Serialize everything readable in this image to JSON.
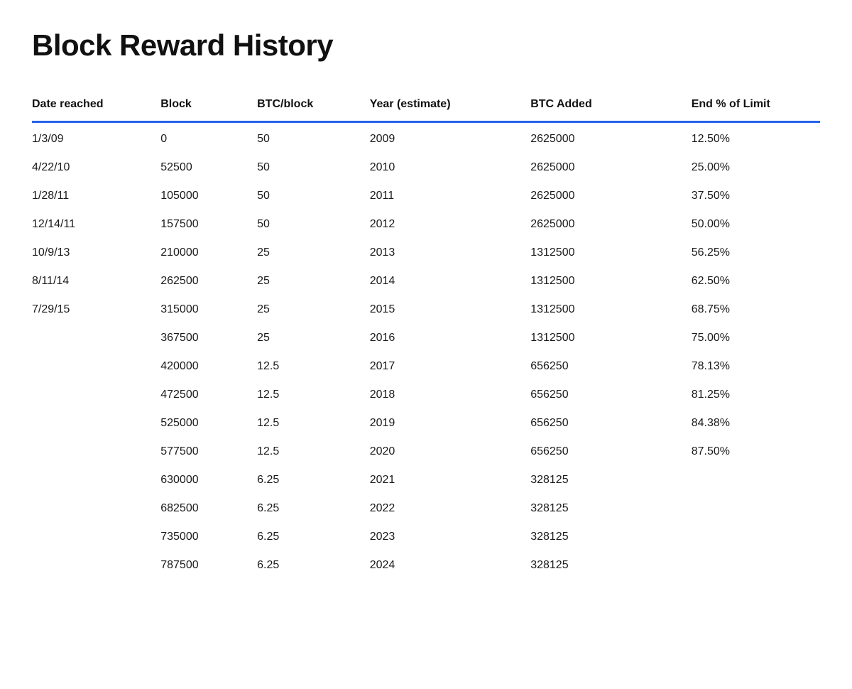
{
  "title": "Block Reward History",
  "columns": {
    "date": "Date reached",
    "block": "Block",
    "btcblock": "BTC/block",
    "year": "Year (estimate)",
    "btcadded": "BTC Added",
    "endlimit": "End % of Limit"
  },
  "rows": [
    {
      "date": "1/3/09",
      "block": "0",
      "btcblock": "50",
      "year": "2009",
      "btcadded": "2625000",
      "endlimit": "12.50%"
    },
    {
      "date": "4/22/10",
      "block": "52500",
      "btcblock": "50",
      "year": "2010",
      "btcadded": "2625000",
      "endlimit": "25.00%"
    },
    {
      "date": "1/28/11",
      "block": "105000",
      "btcblock": "50",
      "year": "2011",
      "btcadded": "2625000",
      "endlimit": "37.50%"
    },
    {
      "date": "12/14/11",
      "block": "157500",
      "btcblock": "50",
      "year": "2012",
      "btcadded": "2625000",
      "endlimit": "50.00%"
    },
    {
      "date": "10/9/13",
      "block": "210000",
      "btcblock": "25",
      "year": "2013",
      "btcadded": "1312500",
      "endlimit": "56.25%"
    },
    {
      "date": "8/11/14",
      "block": "262500",
      "btcblock": "25",
      "year": "2014",
      "btcadded": "1312500",
      "endlimit": "62.50%"
    },
    {
      "date": "7/29/15",
      "block": "315000",
      "btcblock": "25",
      "year": "2015",
      "btcadded": "1312500",
      "endlimit": "68.75%"
    },
    {
      "date": "",
      "block": "367500",
      "btcblock": "25",
      "year": "2016",
      "btcadded": "1312500",
      "endlimit": "75.00%"
    },
    {
      "date": "",
      "block": "420000",
      "btcblock": "12.5",
      "year": "2017",
      "btcadded": "656250",
      "endlimit": "78.13%"
    },
    {
      "date": "",
      "block": "472500",
      "btcblock": "12.5",
      "year": "2018",
      "btcadded": "656250",
      "endlimit": "81.25%"
    },
    {
      "date": "",
      "block": "525000",
      "btcblock": "12.5",
      "year": "2019",
      "btcadded": "656250",
      "endlimit": "84.38%"
    },
    {
      "date": "",
      "block": "577500",
      "btcblock": "12.5",
      "year": "2020",
      "btcadded": "656250",
      "endlimit": "87.50%"
    },
    {
      "date": "",
      "block": "630000",
      "btcblock": "6.25",
      "year": "2021",
      "btcadded": "328125",
      "endlimit": ""
    },
    {
      "date": "",
      "block": "682500",
      "btcblock": "6.25",
      "year": "2022",
      "btcadded": "328125",
      "endlimit": ""
    },
    {
      "date": "",
      "block": "735000",
      "btcblock": "6.25",
      "year": "2023",
      "btcadded": "328125",
      "endlimit": ""
    },
    {
      "date": "",
      "block": "787500",
      "btcblock": "6.25",
      "year": "2024",
      "btcadded": "328125",
      "endlimit": ""
    }
  ]
}
